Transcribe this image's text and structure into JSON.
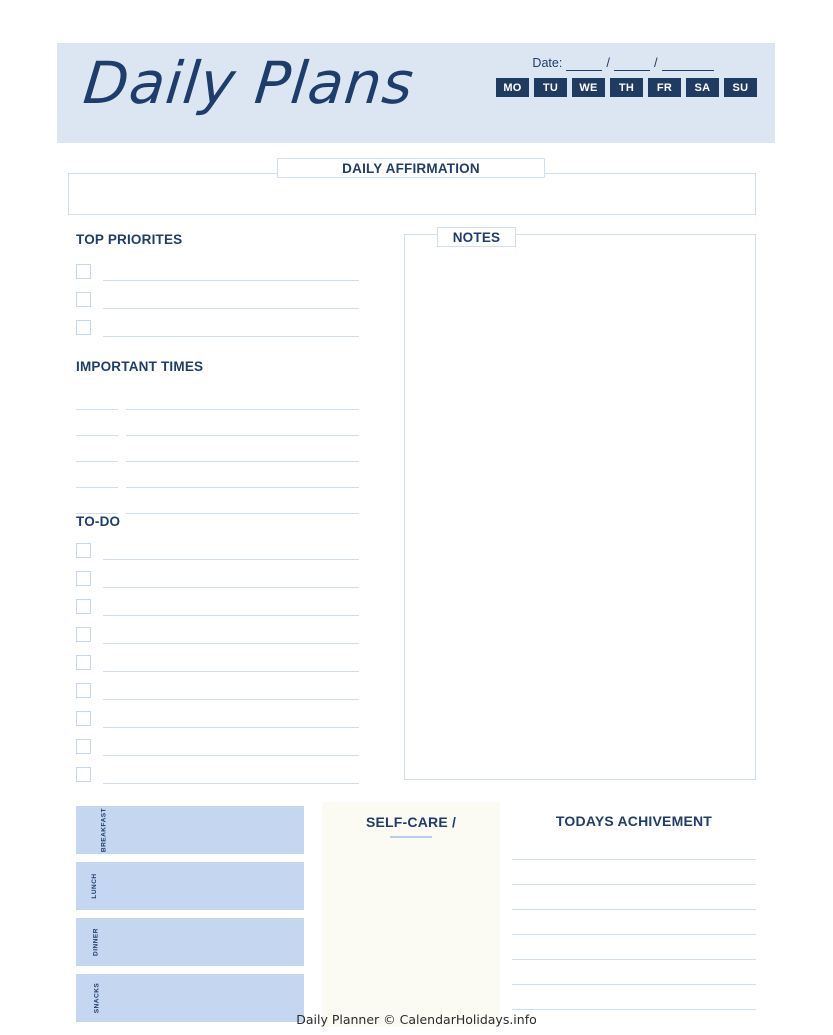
{
  "page": {
    "title": "Daily Plans",
    "footer": "Daily Planner © CalendarHolidays.info"
  },
  "colors": {
    "header_band": "#dce6f2",
    "ink": "#1f3d6b",
    "rule": "#cfdff0",
    "day_button": "#1e3b61",
    "meal_fill": "#c5d7f0",
    "selfcare_fill": "#fbfbf3"
  },
  "header": {
    "date_label": "Date:",
    "separator": "/",
    "days": [
      {
        "label": "MO"
      },
      {
        "label": "TU"
      },
      {
        "label": "WE"
      },
      {
        "label": "TH"
      },
      {
        "label": "FR"
      },
      {
        "label": "SA"
      },
      {
        "label": "SU"
      }
    ]
  },
  "affirmation": {
    "label": "DAILY AFFIRMATION",
    "value": "",
    "placeholder": ""
  },
  "notes": {
    "label": "NOTES",
    "value": "",
    "placeholder": ""
  },
  "top_priorities": {
    "title": "TOP PRIORITES",
    "rows": [
      {
        "checked": false,
        "value": ""
      },
      {
        "checked": false,
        "value": ""
      },
      {
        "checked": false,
        "value": ""
      }
    ]
  },
  "important_times": {
    "title": "IMPORTANT TIMES",
    "rows": [
      {
        "time": "",
        "value": ""
      },
      {
        "time": "",
        "value": ""
      },
      {
        "time": "",
        "value": ""
      },
      {
        "time": "",
        "value": ""
      },
      {
        "time": "",
        "value": ""
      }
    ]
  },
  "todo": {
    "title": "TO-DO",
    "rows": [
      {
        "checked": false,
        "value": ""
      },
      {
        "checked": false,
        "value": ""
      },
      {
        "checked": false,
        "value": ""
      },
      {
        "checked": false,
        "value": ""
      },
      {
        "checked": false,
        "value": ""
      },
      {
        "checked": false,
        "value": ""
      },
      {
        "checked": false,
        "value": ""
      },
      {
        "checked": false,
        "value": ""
      },
      {
        "checked": false,
        "value": ""
      }
    ]
  },
  "meals": [
    {
      "label": "BREAKFAST",
      "value": ""
    },
    {
      "label": "LUNCH",
      "value": ""
    },
    {
      "label": "DINNER",
      "value": ""
    },
    {
      "label": "SNACKS",
      "value": ""
    }
  ],
  "self_care": {
    "title": "SELF-CARE /",
    "value": ""
  },
  "achievement": {
    "title": "TODAYS ACHIVEMENT",
    "lines": [
      "",
      "",
      "",
      "",
      "",
      "",
      ""
    ]
  }
}
